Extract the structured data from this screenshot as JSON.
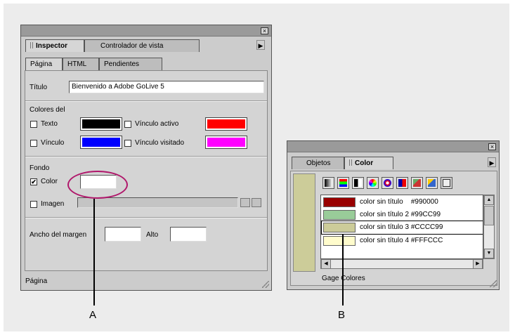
{
  "inspector": {
    "close_glyph": "×",
    "main_tabs": [
      "Inspector",
      "Controlador de vista"
    ],
    "sub_tabs": [
      "Página",
      "HTML",
      "Pendientes"
    ],
    "titulo_label": "Título",
    "titulo_value": "Bienvenido a Adobe GoLive 5",
    "colores_heading": "Colores del",
    "texto_label": "Texto",
    "vinculo_label": "Vínculo",
    "vinculo_activo_label": "Vínculo activo",
    "vinculo_visitado_label": "Vínculo visitado",
    "swatches": {
      "texto": "#000000",
      "vinculo": "#0000ff",
      "vinculo_activo": "#ff0000",
      "vinculo_visitado": "#ff00ff"
    },
    "fondo_heading": "Fondo",
    "fondo_color_label": "Color",
    "fondo_color_checked": "✔",
    "imagen_label": "Imagen",
    "ancho_label": "Ancho del margen",
    "alto_label": "Alto",
    "status": "Página"
  },
  "color_palette": {
    "close_glyph": "×",
    "tabs": [
      "Objetos",
      "Color"
    ],
    "preview_color": "#CCCC99",
    "toolbar_icons": [
      "grayscale-slider-icon",
      "rgb-slider-icon",
      "cmyk-slider-icon",
      "color-wheel-icon",
      "hsv-picker-icon",
      "indexed-color-icon",
      "web-color-icon",
      "named-color-icon",
      "site-colors-icon"
    ],
    "swatches": [
      {
        "name": "color sin título",
        "hex": "#990000"
      },
      {
        "name": "color sin título 2",
        "hex": "#99CC99"
      },
      {
        "name": "color sin título 3",
        "hex": "#CCCC99"
      },
      {
        "name": "color sin título 4",
        "hex": "#FFFCCC"
      }
    ],
    "status": "Gage Colores"
  },
  "callouts": {
    "a": "A",
    "b": "B"
  },
  "colors": {
    "highlight_oval": "#b0176b"
  }
}
